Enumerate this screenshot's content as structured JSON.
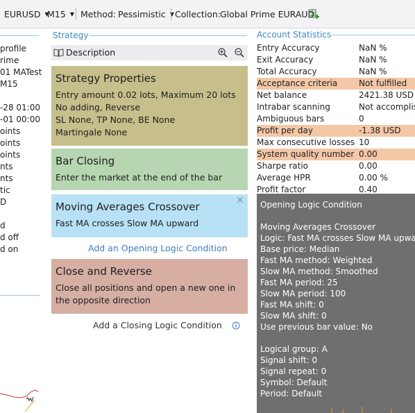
{
  "toolbar": {
    "symbol": "EURUSD",
    "timeframe": "M15",
    "method_label": "Method:",
    "method_value": "Pessimistic",
    "collection_label": "Collection:",
    "collection_value": "Global Prime EURAUD"
  },
  "left_panel": {
    "lines": [
      "profile",
      "rime",
      "01 MATest",
      "M15",
      "-28 01:00",
      "-01 00:00",
      "oints",
      "oints",
      "oints",
      "nts",
      "nts",
      "tic",
      "D",
      "d",
      "d off",
      "d on"
    ]
  },
  "strategy": {
    "header": "Strategy",
    "description_label": "Description",
    "properties": {
      "title": "Strategy Properties",
      "lines": [
        "Entry amount 0.02 lots, Maximum 20 lots",
        "No adding, Reverse",
        "SL None,  TP None,  BE None",
        "Martingale None"
      ],
      "bg": "#c6bf8b"
    },
    "bar_closing": {
      "title": "Bar Closing",
      "line": "Enter the market at the end of the bar",
      "bg": "#b6d6b1"
    },
    "opening": {
      "title": "Moving Averages Crossover",
      "line": "Fast MA crosses Slow MA upward",
      "bg": "#b8e1f6"
    },
    "add_opening": "Add an Opening Logic Condition",
    "closing": {
      "title": "Close and Reverse",
      "lines": [
        "Close all positions and open a new one in",
        "the opposite direction"
      ],
      "bg": "#d6aea2"
    },
    "add_closing": "Add a Closing Logic Condition"
  },
  "account_statistics": {
    "header": "Account Statistics",
    "rows": [
      {
        "label": "Entry Accuracy",
        "value": "NaN %",
        "hl": false
      },
      {
        "label": "Exit Accuracy",
        "value": "NaN %",
        "hl": false
      },
      {
        "label": "Total Accuracy",
        "value": "NaN %",
        "hl": false
      },
      {
        "label": "Acceptance criteria",
        "value": "Not fulfilled",
        "hl": true
      },
      {
        "label": "Net balance",
        "value": "2421.38 USD",
        "hl": false
      },
      {
        "label": "Intrabar scanning",
        "value": "Not accomplish",
        "hl": false
      },
      {
        "label": "Ambiguous bars",
        "value": "0",
        "hl": false
      },
      {
        "label": "Profit per day",
        "value": "-1.38 USD",
        "hl": true
      },
      {
        "label": "Max consecutive losses",
        "value": "10",
        "hl": false
      },
      {
        "label": "System quality number",
        "value": "0.00",
        "hl": true
      },
      {
        "label": "Sharpe ratio",
        "value": "0.00",
        "hl": false
      },
      {
        "label": "Average HPR",
        "value": "0.00 %",
        "hl": false
      },
      {
        "label": "Profit factor",
        "value": "0.40",
        "hl": false
      }
    ],
    "highlight_color": "#f4c7a6"
  },
  "tooltip": {
    "lines": [
      "Opening Logic Condition",
      "",
      "Moving Averages Crossover",
      "Logic: Fast MA crosses Slow MA upward",
      "Base price: Median",
      "Fast MA method: Weighted",
      "Slow MA method: Smoothed",
      "Fast MA period: 25",
      "Slow MA period: 100",
      "Fast MA shift: 0",
      "Slow MA shift: 0",
      "Use previous bar value: No",
      "",
      "Logical group: A",
      "Signal shift: 0",
      "Signal repeat: 0",
      "Symbol: Default",
      "Period: Default"
    ]
  },
  "colors": {
    "accent": "#3a88c8",
    "link": "#3b7cc2",
    "tooltip_bg": "#6f6f6f"
  }
}
